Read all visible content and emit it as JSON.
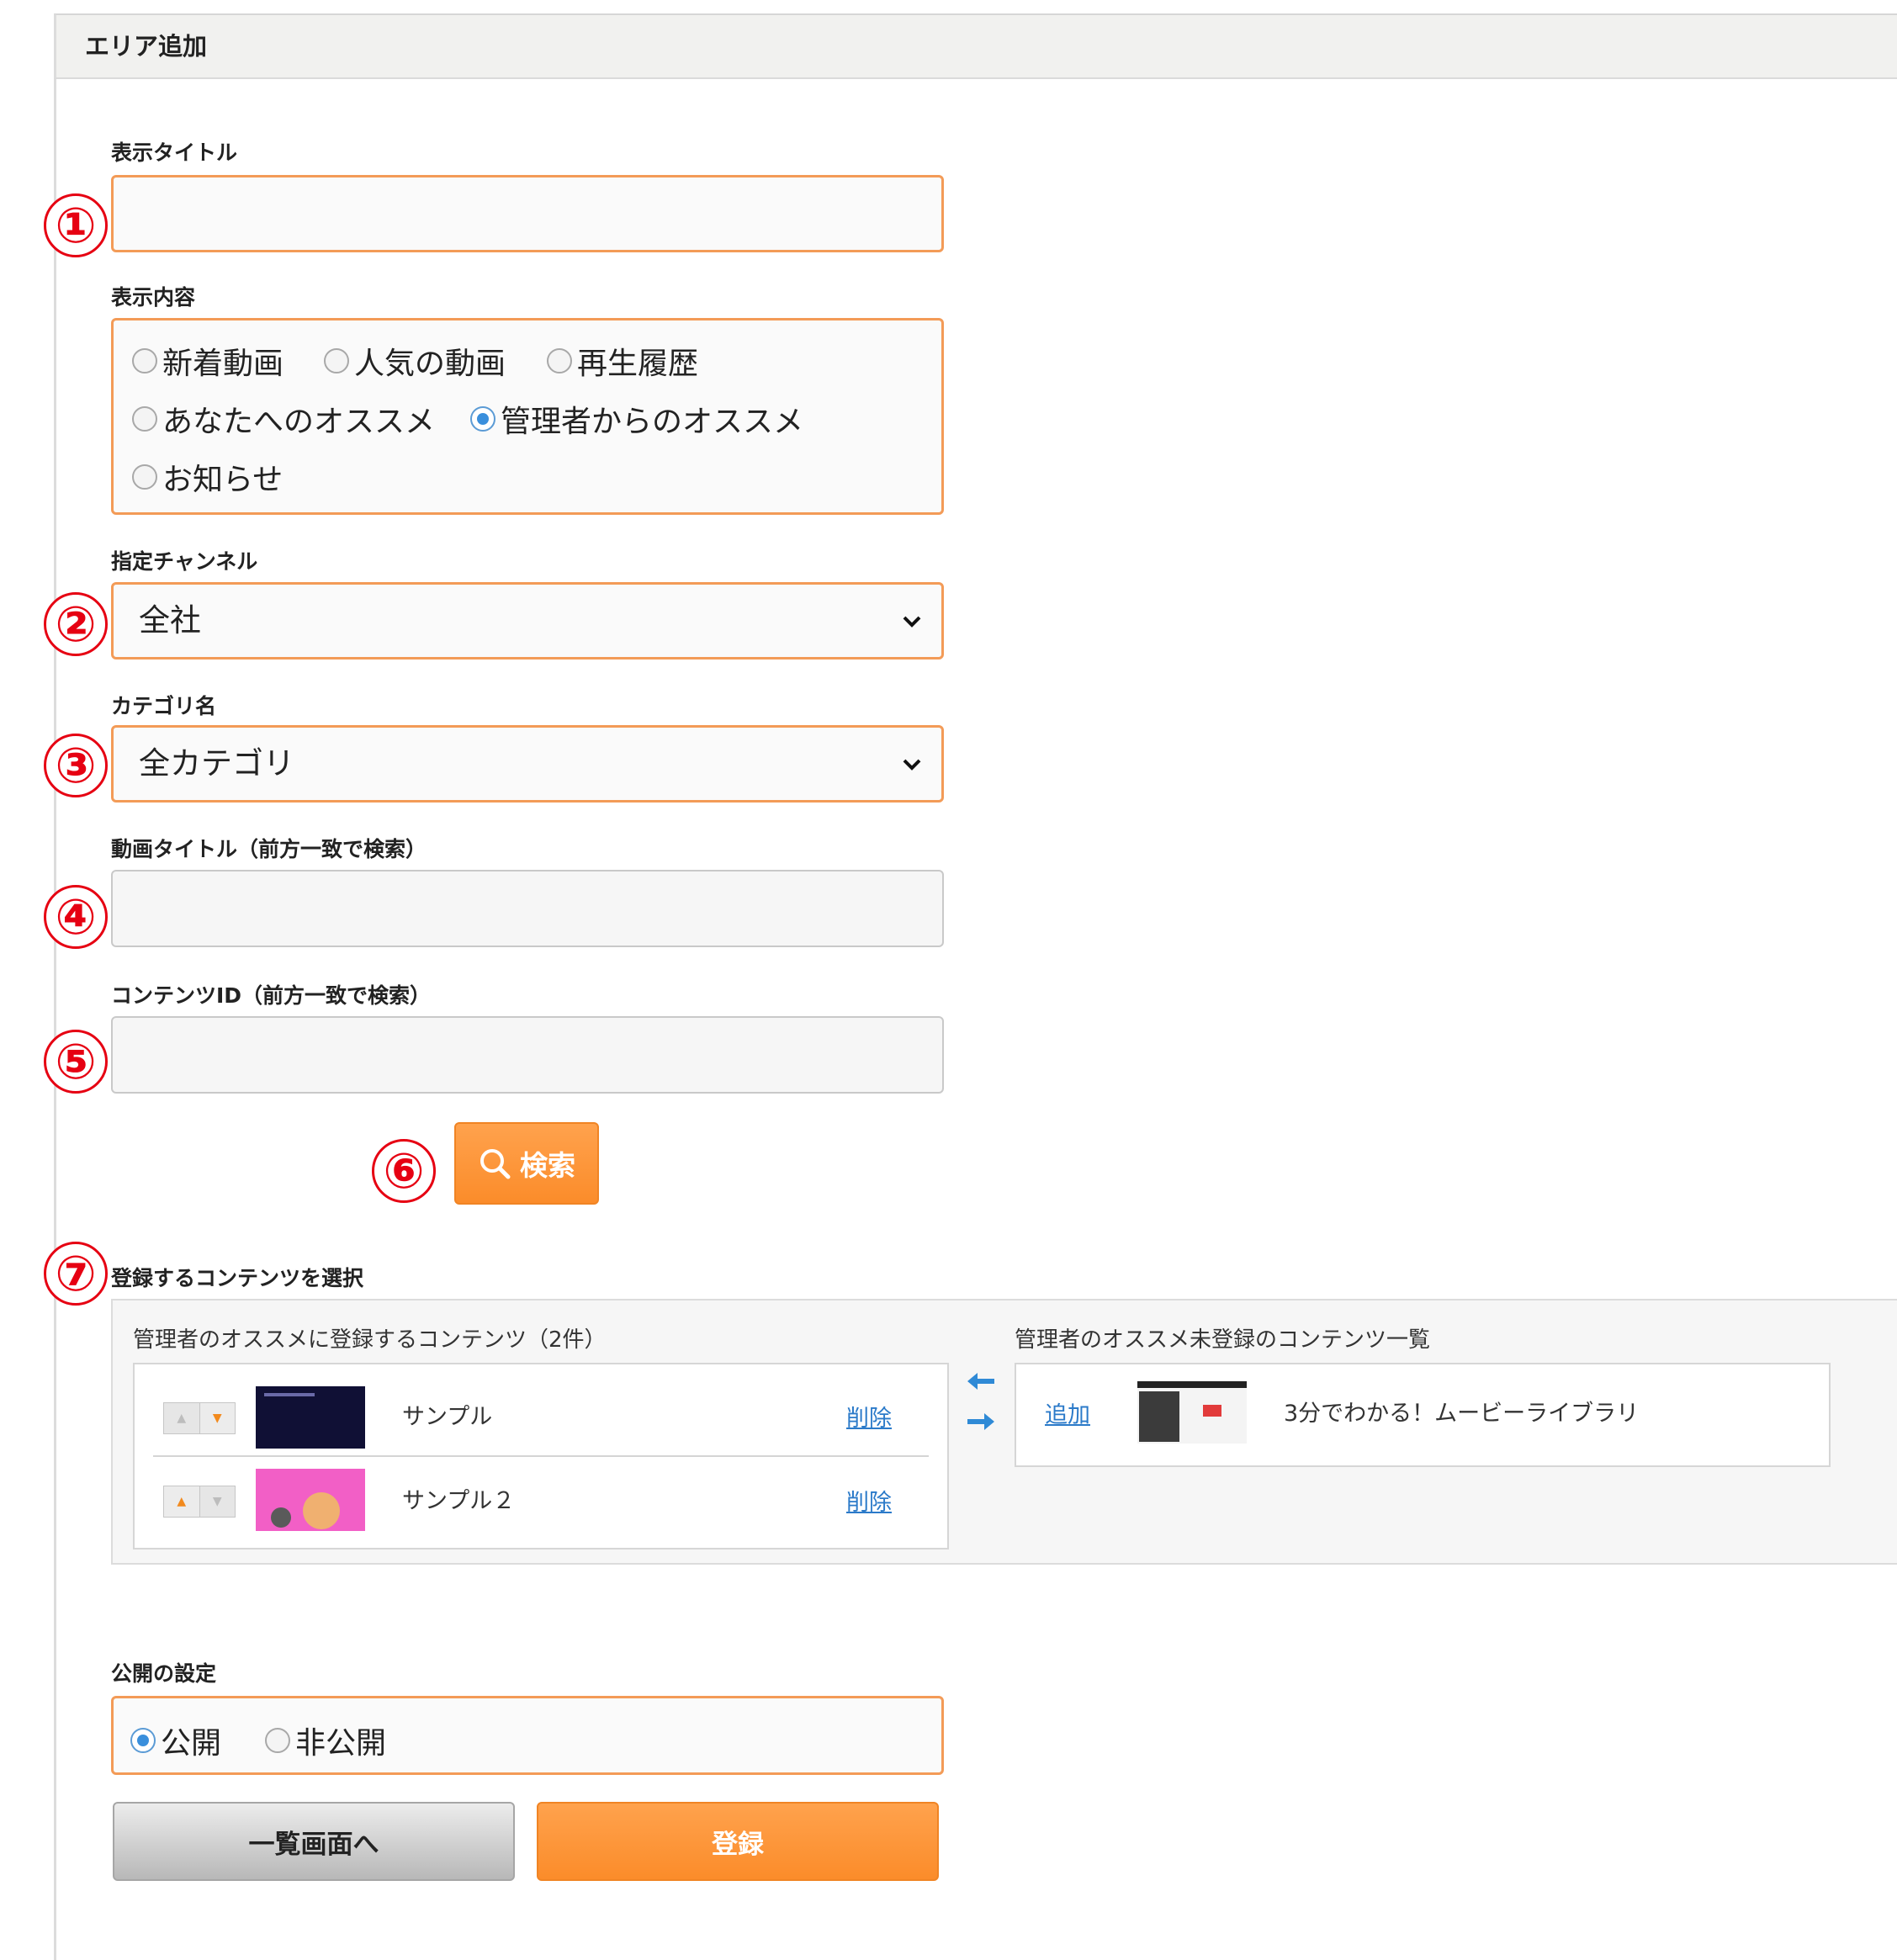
{
  "panel": {
    "title": "エリア追加"
  },
  "fields": {
    "display_title": {
      "label": "表示タイトル",
      "value": ""
    },
    "display_content": {
      "label": "表示内容",
      "options": [
        "新着動画",
        "人気の動画",
        "再生履歴",
        "あなたへのオススメ",
        "管理者からのオススメ",
        "お知らせ"
      ],
      "selected": "管理者からのオススメ"
    },
    "channel": {
      "label": "指定チャンネル",
      "value": "全社"
    },
    "category": {
      "label": "カテゴリ名",
      "value": "全カテゴリ"
    },
    "video_title": {
      "label": "動画タイトル（前方一致で検索）",
      "value": ""
    },
    "content_id": {
      "label": "コンテンツID（前方一致で検索）",
      "value": ""
    }
  },
  "search_button": {
    "label": "検索",
    "icon": "search-icon"
  },
  "content_select": {
    "label": "登録するコンテンツを選択",
    "registered_heading": "管理者のオススメに登録するコンテンツ（2件）",
    "registered_items": [
      {
        "title": "サンプル",
        "action": "削除"
      },
      {
        "title": "サンプル２",
        "action": "削除"
      }
    ],
    "unregistered_heading": "管理者のオススメ未登録のコンテンツ一覧",
    "unregistered_items": [
      {
        "title": "3分でわかる！ムービーライブラリ",
        "action": "追加"
      }
    ]
  },
  "publish": {
    "label": "公開の設定",
    "options": [
      "公開",
      "非公開"
    ],
    "selected": "公開"
  },
  "buttons": {
    "back": "一覧画面へ",
    "submit": "登録"
  },
  "markers": [
    "①",
    "②",
    "③",
    "④",
    "⑤",
    "⑥",
    "⑦"
  ],
  "colors": {
    "accent": "#fb8c2a",
    "marker": "#e60012",
    "link": "#2b7ac9",
    "radio_selected": "#3a8fdc"
  }
}
